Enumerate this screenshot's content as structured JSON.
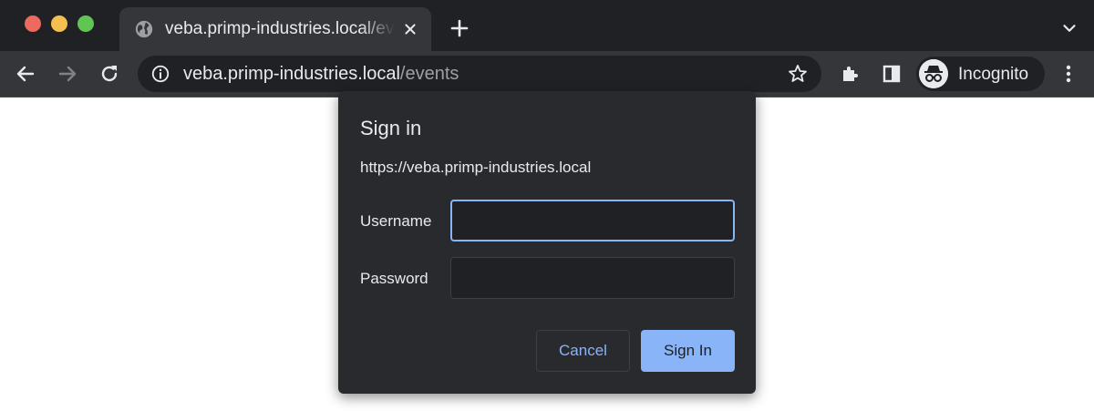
{
  "tab": {
    "title": "veba.primp-industries.local/events"
  },
  "omnibox": {
    "host": "veba.primp-industries.local",
    "path": "/events"
  },
  "profile": {
    "label": "Incognito"
  },
  "dialog": {
    "title": "Sign in",
    "origin": "https://veba.primp-industries.local",
    "username_label": "Username",
    "username_value": "",
    "password_label": "Password",
    "password_value": "",
    "cancel_label": "Cancel",
    "signin_label": "Sign In"
  },
  "colors": {
    "accent": "#8ab4f8",
    "tabstrip": "#202124",
    "toolbar": "#35363a",
    "dialog": "#292a2d"
  },
  "icons": [
    "globe-icon",
    "close-icon",
    "plus-icon",
    "chevron-down-icon",
    "back-arrow-icon",
    "forward-arrow-icon",
    "reload-icon",
    "info-icon",
    "star-icon",
    "extensions-puzzle-icon",
    "side-panel-icon",
    "incognito-icon",
    "more-vert-icon"
  ]
}
